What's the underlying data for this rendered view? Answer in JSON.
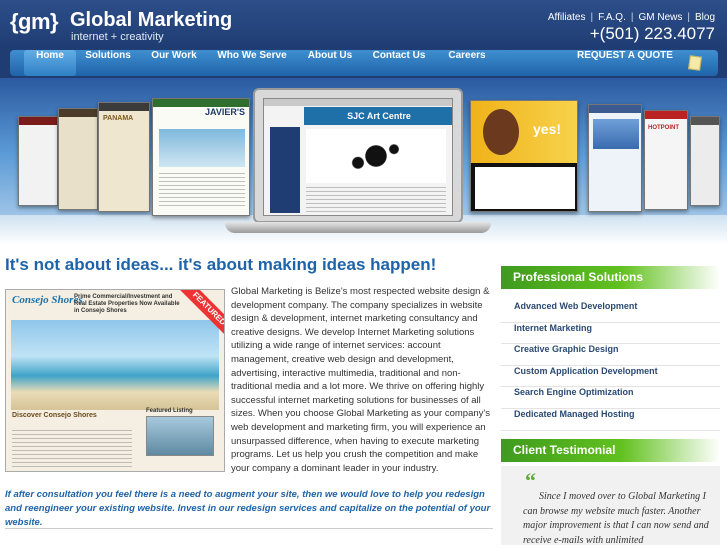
{
  "header": {
    "logo_gm": "{gm}",
    "logo_name": "Global Marketing",
    "tagline": "internet + creativity",
    "top_links": [
      "Affiliates",
      "F.A.Q.",
      "GM News",
      "Blog"
    ],
    "top_separator": "|",
    "phone": "+(501) 223.4077"
  },
  "nav": {
    "items": [
      "Home",
      "Solutions",
      "Our Work",
      "Who We Serve",
      "About Us",
      "Contact Us",
      "Careers"
    ],
    "active": "Home",
    "quote_label": "REQUEST A QUOTE"
  },
  "banner": {
    "shot_javier": "JAVIER'S",
    "shot_panama": "PANAMA",
    "shot_sjc": "SJC Art Centre",
    "shot_yes": "yes!",
    "shot_hotpoint": "HOTPOINT"
  },
  "main": {
    "headline": "It's not about ideas... it's about making ideas happen!",
    "feature": {
      "logo": "Consejo Shores",
      "header": "Prime Commercial/Investment and Real Estate Properties Now Available in Consejo Shores",
      "ribbon": "FEATURED",
      "subheading": "Discover Consejo Shores",
      "listing": "Featured Listing"
    },
    "intro": "Global Marketing is Belize's most respected website design & development company. The company specializes in website design & development, internet marketing consultancy and creative designs. We develop Internet Marketing solutions utilizing a wide range of internet services: account management, creative web design and development, advertising, interactive multimedia, traditional and non-traditional media and a lot more. We thrive on offering highly successful internet marketing solutions for businesses of all sizes. When you choose Global Marketing as your company's web development and marketing firm, you will experience an unsurpassed difference, when having to execute marketing programs. Let us help you crush the competition and make your company a dominant leader in your industry.",
    "callout": "If after consultation you feel there is a need to augment your site, then we would love to help you redesign and reengineer your existing website. Invest in our redesign services and capitalize on the potential of your website."
  },
  "sidebar": {
    "solutions_title": "Professional Solutions",
    "solutions": [
      "Advanced Web Development",
      "Internet Marketing",
      "Creative Graphic Design",
      "Custom Application Development",
      "Search Engine Optimization",
      "Dedicated Managed Hosting"
    ],
    "testimonial_title": "Client Testimonial",
    "testimonial_quote_mark": "“",
    "testimonial_text": "Since I moved over to Global Marketing I can browse my website much faster. Another major improvement is that I can now send and receive e-mails with unlimited"
  },
  "colors": {
    "header_bg": "#1f3d73",
    "nav_blue": "#1f63a8",
    "headline_blue": "#1f63a8",
    "sidebar_green": "#62c11f",
    "sidebar_text": "#2b4a72"
  }
}
